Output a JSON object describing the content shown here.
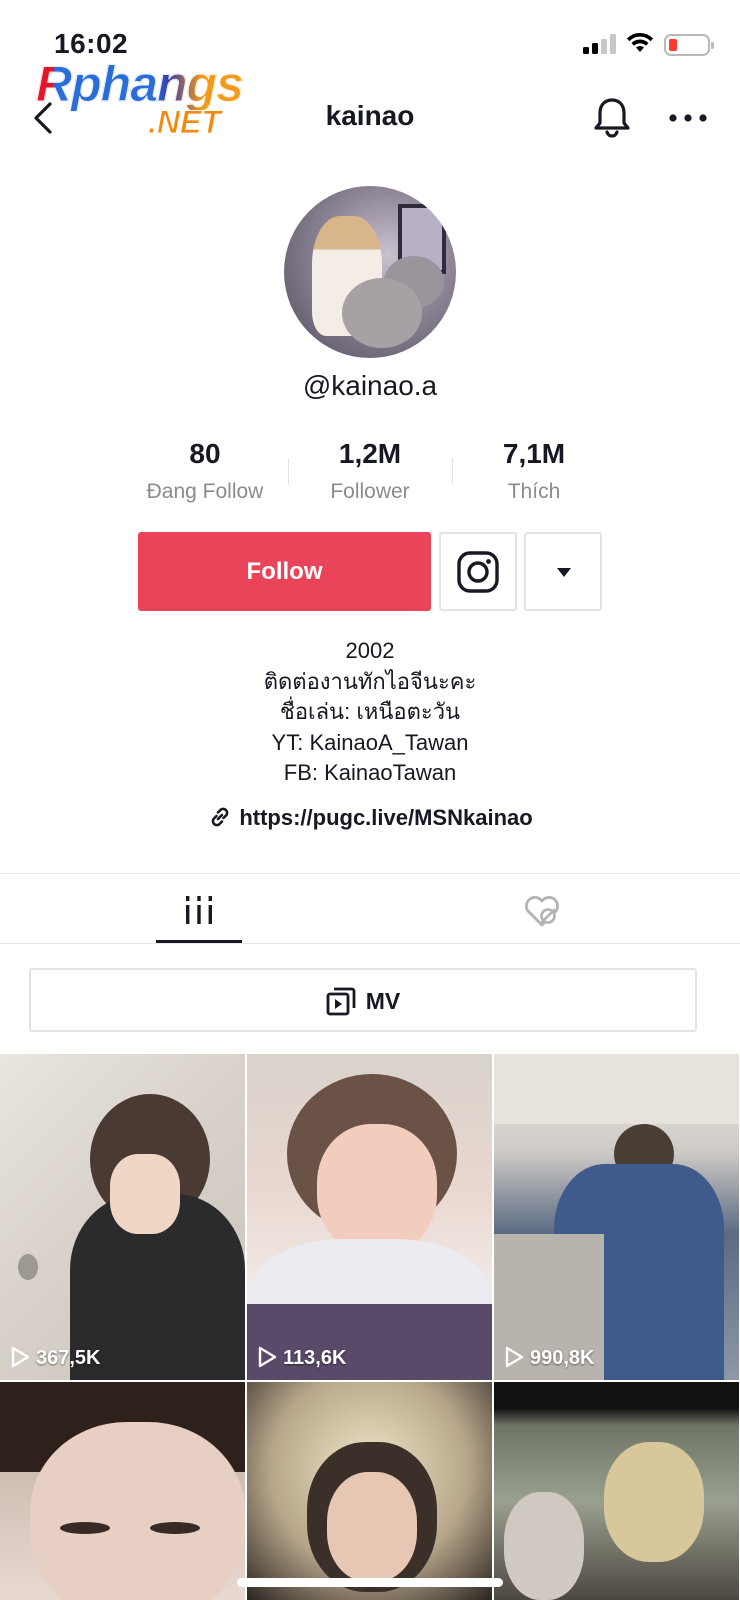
{
  "status_bar": {
    "time": "16:02"
  },
  "watermark": {
    "line1": "Rphangs",
    "line2": ".NET"
  },
  "nav": {
    "title": "kainao"
  },
  "profile": {
    "handle": "@kainao.a",
    "stats": [
      {
        "value": "80",
        "label": "Đang Follow"
      },
      {
        "value": "1,2M",
        "label": "Follower"
      },
      {
        "value": "7,1M",
        "label": "Thích"
      }
    ]
  },
  "actions": {
    "follow_label": "Follow"
  },
  "bio": {
    "lines": [
      "2002",
      "ติดต่องานทักไอจีนะคะ",
      "ชื่อเล่น: เหนือตะวัน",
      "YT: KainaoA_Tawan",
      "FB: KainaoTawan"
    ],
    "link": "https://pugc.live/MSNkainao"
  },
  "mv": {
    "label": "MV"
  },
  "videos": [
    {
      "views": "367,5K"
    },
    {
      "views": "113,6K"
    },
    {
      "views": "990,8K"
    },
    {
      "views": ""
    },
    {
      "views": ""
    },
    {
      "views": ""
    }
  ],
  "colors": {
    "accent": "#ea445a",
    "text": "#161823",
    "muted": "#8a8b91"
  }
}
